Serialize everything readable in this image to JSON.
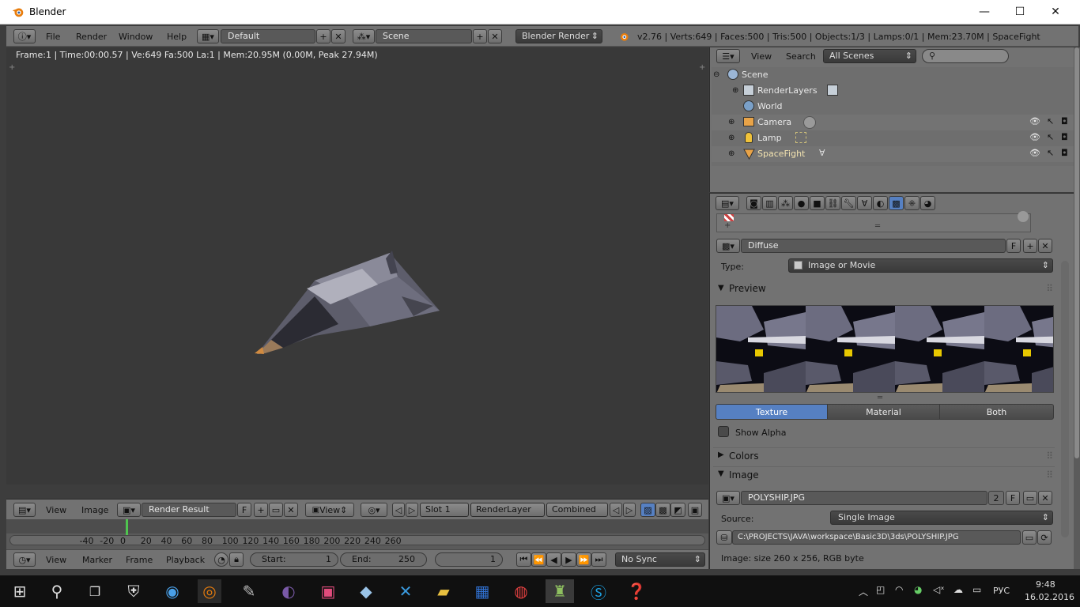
{
  "window": {
    "title": "Blender",
    "minimize": "—",
    "maximize": "☐",
    "close": "✕"
  },
  "info_header": {
    "menus": [
      "File",
      "Render",
      "Window",
      "Help"
    ],
    "layout": "Default",
    "scene": "Scene",
    "engine": "Blender Render",
    "stats": "v2.76 | Verts:649 | Faces:500 | Tris:500 | Objects:1/3 | Lamps:0/1 | Mem:23.70M | SpaceFight"
  },
  "viewport": {
    "stats": "Frame:1 | Time:00:00.57 | Ve:649 Fa:500 La:1 | Mem:20.95M (0.00M, Peak 27.94M)",
    "plus": "+"
  },
  "image_header": {
    "menus": [
      "View",
      "Image"
    ],
    "image_name": "Render Result",
    "f_label": "F",
    "view": "View",
    "slot": "Slot 1",
    "layer": "RenderLayer",
    "pass": "Combined"
  },
  "timeline": {
    "ticks": [
      "-40",
      "-20",
      "0",
      "20",
      "40",
      "60",
      "80",
      "100",
      "120",
      "140",
      "160",
      "180",
      "200",
      "220",
      "240",
      "260"
    ],
    "current_frame_marker": 0,
    "menus": [
      "View",
      "Marker",
      "Frame",
      "Playback"
    ],
    "start_label": "Start:",
    "start": "1",
    "end_label": "End:",
    "end": "250",
    "current": "1",
    "sync": "No Sync"
  },
  "outliner": {
    "menus": [
      "View",
      "Search"
    ],
    "filter": "All Scenes",
    "items": [
      {
        "label": "Scene",
        "icon": "scene-icon"
      },
      {
        "label": "RenderLayers",
        "icon": "renderlayers-icon"
      },
      {
        "label": "World",
        "icon": "world-icon"
      },
      {
        "label": "Camera",
        "icon": "camera-icon"
      },
      {
        "label": "Lamp",
        "icon": "lamp-icon"
      },
      {
        "label": "SpaceFight",
        "icon": "mesh-icon"
      }
    ]
  },
  "properties": {
    "texture_name": "Diffuse",
    "f_label": "F",
    "type_label": "Type:",
    "type_value": "Image or Movie",
    "preview_label": "Preview",
    "preview_tabs": [
      "Texture",
      "Material",
      "Both"
    ],
    "show_alpha": "Show Alpha",
    "colors_label": "Colors",
    "image_label": "Image",
    "image_name": "POLYSHIP.JPG",
    "users": "2",
    "source_label": "Source:",
    "source_value": "Single Image",
    "filepath": "C:\\PROJECTS\\JAVA\\workspace\\Basic3D\\3ds\\POLYSHIP.JPG",
    "image_info": "Image: size 260 x 256, RGB byte"
  },
  "taskbar": {
    "lang": "РУС",
    "time": "9:48",
    "date": "16.02.2016"
  },
  "colors": {
    "accent_blue": "#5680c2",
    "blender_orange": "#e87d0d",
    "frame_marker": "#4fc44f"
  }
}
